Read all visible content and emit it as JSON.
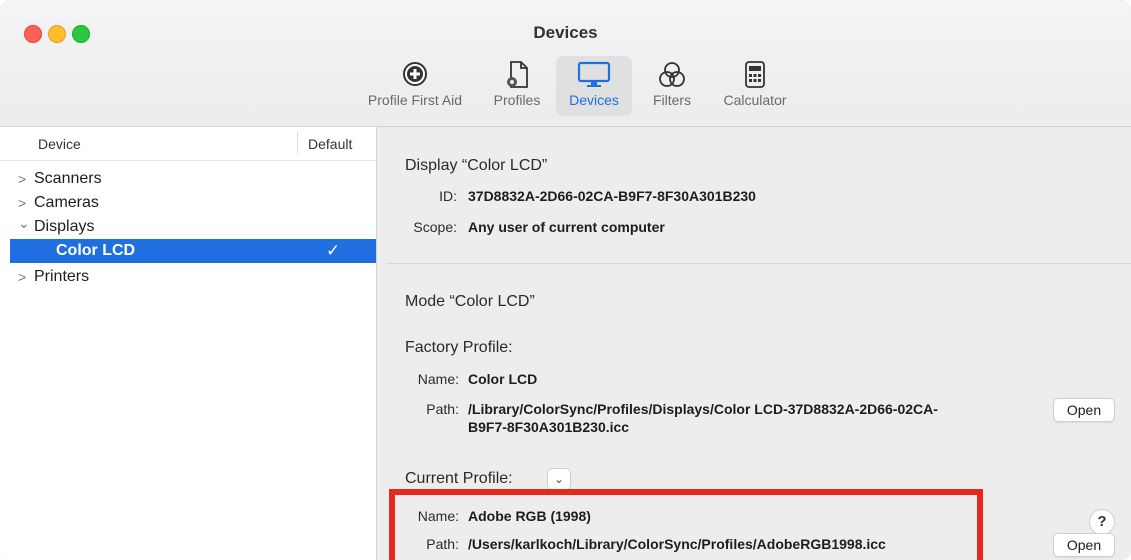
{
  "window": {
    "title": "Devices"
  },
  "toolbar": {
    "items": [
      {
        "label": "Profile First Aid",
        "icon": "plus-circle-icon"
      },
      {
        "label": "Profiles",
        "icon": "document-gear-icon"
      },
      {
        "label": "Devices",
        "icon": "display-icon",
        "selected": true
      },
      {
        "label": "Filters",
        "icon": "overlapping-circles-icon"
      },
      {
        "label": "Calculator",
        "icon": "calculator-icon"
      }
    ]
  },
  "sidebar": {
    "col_device": "Device",
    "col_default": "Default",
    "items": [
      {
        "label": "Scanners",
        "disclosure": ">"
      },
      {
        "label": "Cameras",
        "disclosure": ">"
      },
      {
        "label": "Displays",
        "disclosure": "⌄"
      },
      {
        "label": "Color LCD",
        "check": "✓"
      },
      {
        "label": "Printers",
        "disclosure": ">"
      }
    ]
  },
  "detail": {
    "display_title": "Display “Color LCD”",
    "id_label": "ID:",
    "id_value": "37D8832A-2D66-02CA-B9F7-8F30A301B230",
    "scope_label": "Scope:",
    "scope_value": "Any user of current computer",
    "mode_title": "Mode “Color LCD”",
    "factory_title": "Factory Profile:",
    "factory_name_label": "Name:",
    "factory_name_value": "Color LCD",
    "factory_path_label": "Path:",
    "factory_path_line1": "/Library/ColorSync/Profiles/Displays/Color LCD-37D8832A-2D66-02CA-",
    "factory_path_line2": "B9F7-8F30A301B230.icc",
    "open_label": "Open",
    "current_title": "Current Profile:",
    "dropdown_glyph": "⌄",
    "current_name_label": "Name:",
    "current_name_value": "Adobe RGB (1998)",
    "current_path_label": "Path:",
    "current_path_value": "/Users/karlkoch/Library/ColorSync/Profiles/AdobeRGB1998.icc",
    "help_glyph": "?"
  },
  "colors": {
    "accent": "#1f6fe0",
    "highlight": "#e8281c"
  }
}
